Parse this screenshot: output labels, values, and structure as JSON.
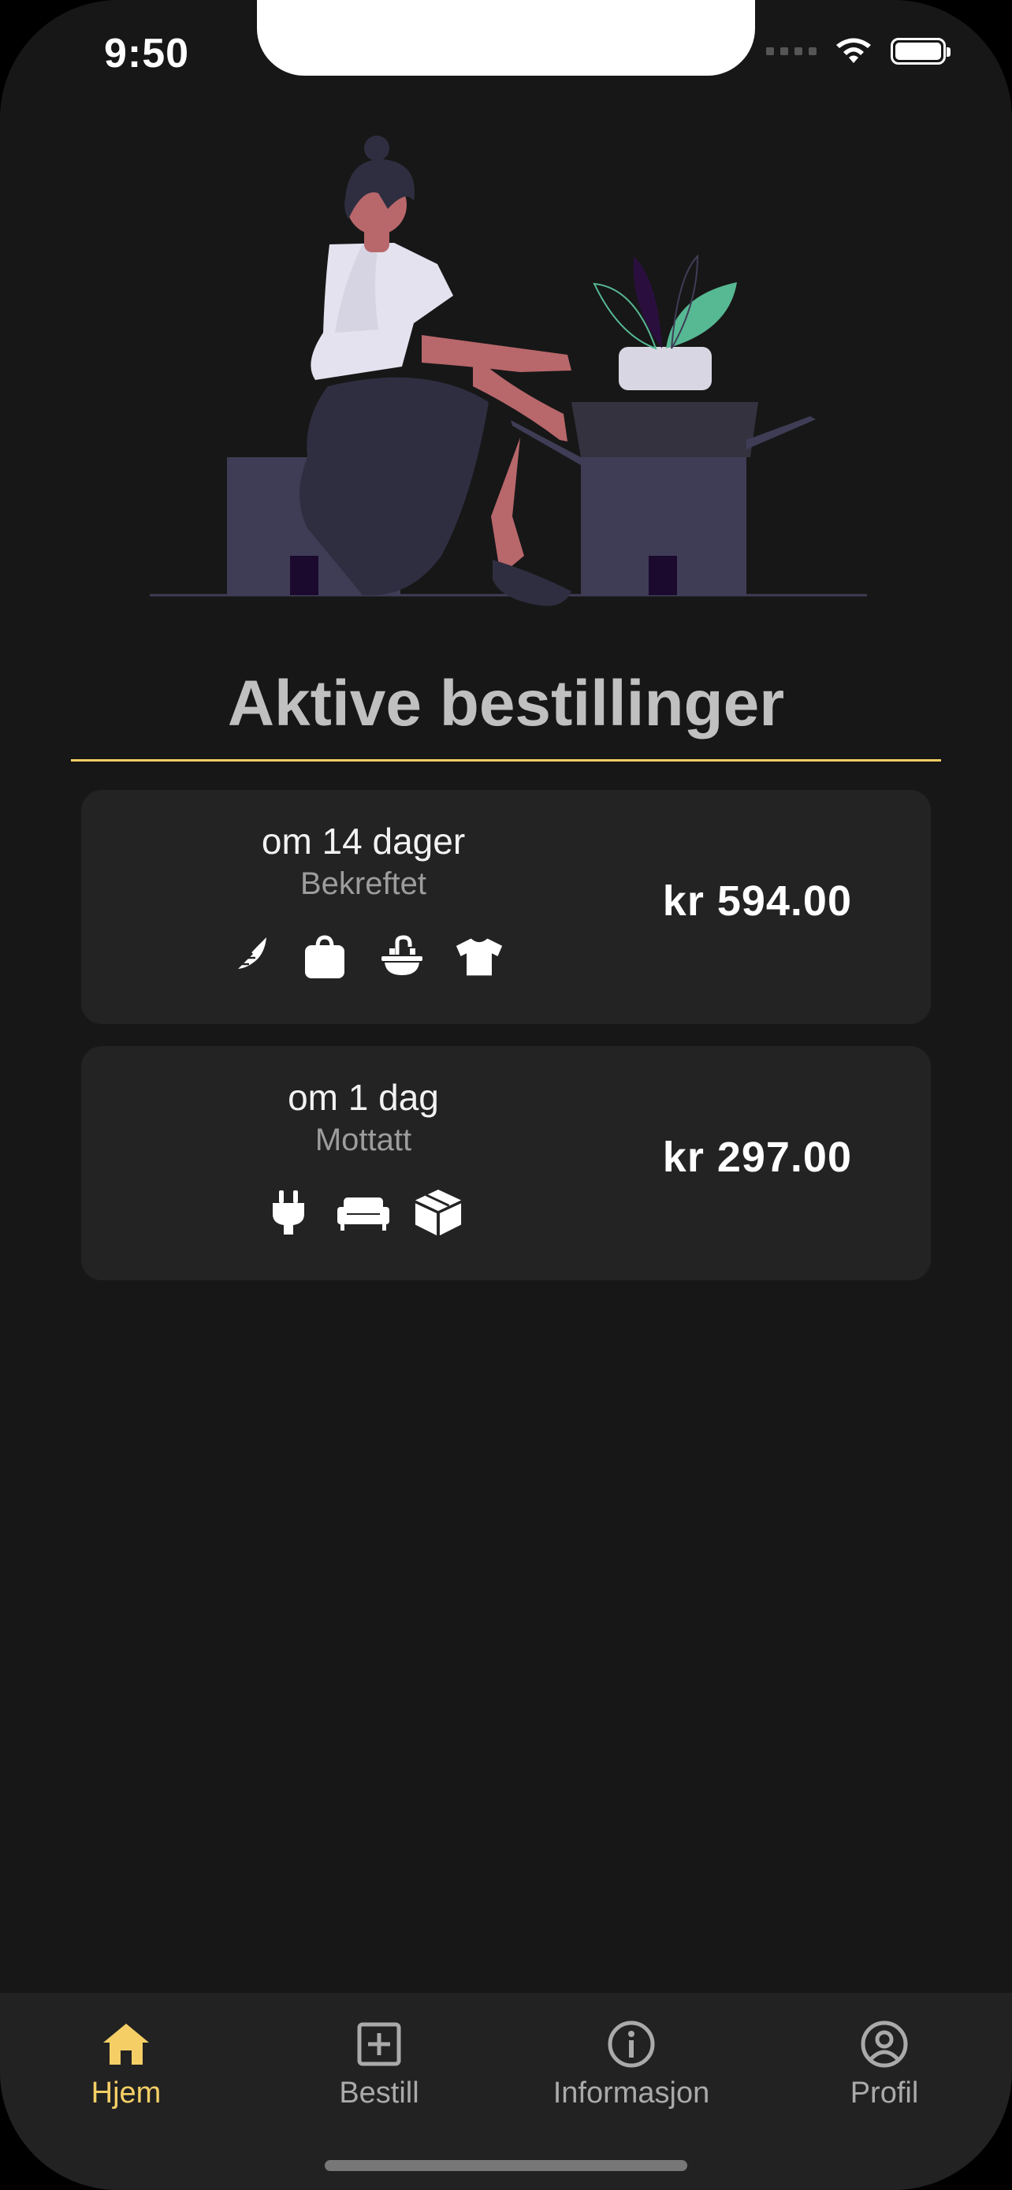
{
  "status_bar": {
    "time": "9:50"
  },
  "heading": "Aktive bestillinger",
  "orders": [
    {
      "eta": "om 14 dager",
      "status": "Bekreftet",
      "price": "kr 594.00",
      "icons": [
        "feather-icon",
        "bag-icon",
        "sink-icon",
        "tshirt-icon"
      ]
    },
    {
      "eta": "om 1 dag",
      "status": "Mottatt",
      "price": "kr 297.00",
      "icons": [
        "plug-icon",
        "couch-icon",
        "box-icon"
      ]
    }
  ],
  "tabs": [
    {
      "label": "Hjem",
      "icon": "home-icon",
      "active": true
    },
    {
      "label": "Bestill",
      "icon": "plus-square-icon",
      "active": false
    },
    {
      "label": "Informasjon",
      "icon": "info-icon",
      "active": false
    },
    {
      "label": "Profil",
      "icon": "user-circle-icon",
      "active": false
    }
  ],
  "colors": {
    "background": "#171717",
    "card": "#232323",
    "accent": "#f5cf66",
    "divider": "#f2cd62"
  }
}
